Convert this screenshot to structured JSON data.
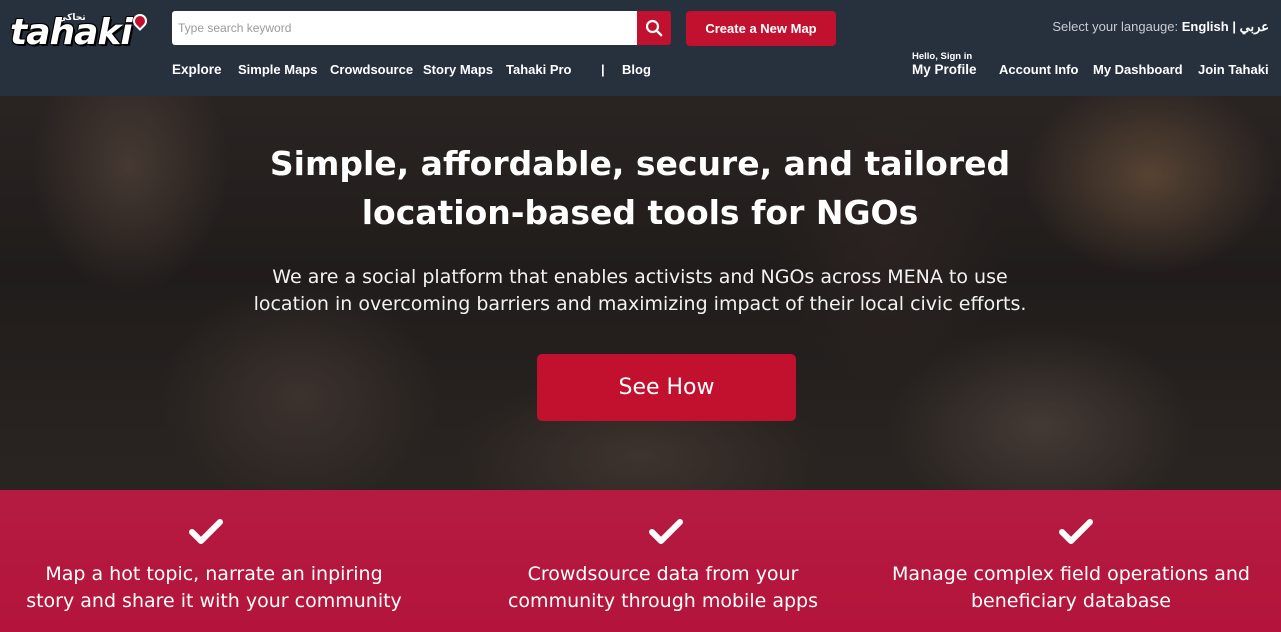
{
  "header": {
    "logo_text": "tahaki",
    "logo_arabic": "تحاكي",
    "search": {
      "placeholder": "Type search keyword"
    },
    "create_button": "Create a New Map",
    "language": {
      "label": "Select your langauge:",
      "english": "English",
      "separator": "|",
      "arabic": "عربي"
    },
    "nav_left": [
      "Explore",
      "Simple Maps",
      "Crowdsource",
      "Story Maps",
      "Tahaki Pro",
      "|",
      "Blog"
    ],
    "profile": {
      "hello": "Hello, Sign in",
      "label": "My Profile"
    },
    "nav_right": [
      "Account Info",
      "My Dashboard",
      "Join Tahaki"
    ]
  },
  "hero": {
    "title_line1": "Simple, affordable, secure, and tailored",
    "title_line2": "location-based tools for NGOs",
    "subtitle_line1": "We are a social platform that enables activists and NGOs across MENA to use",
    "subtitle_line2": "location in overcoming barriers and maximizing impact of their local civic efforts.",
    "cta": "See How"
  },
  "features": [
    {
      "line1": "Map a hot topic, narrate an inpiring",
      "line2": "story and share it with your community"
    },
    {
      "line1": "Crowdsource data from your",
      "line2": "community through mobile apps"
    },
    {
      "line1": "Manage complex field operations and",
      "line2": "beneficiary database"
    }
  ],
  "colors": {
    "header_bg": "#27303d",
    "accent": "#c2102f",
    "features_bg": "#b4143b"
  }
}
